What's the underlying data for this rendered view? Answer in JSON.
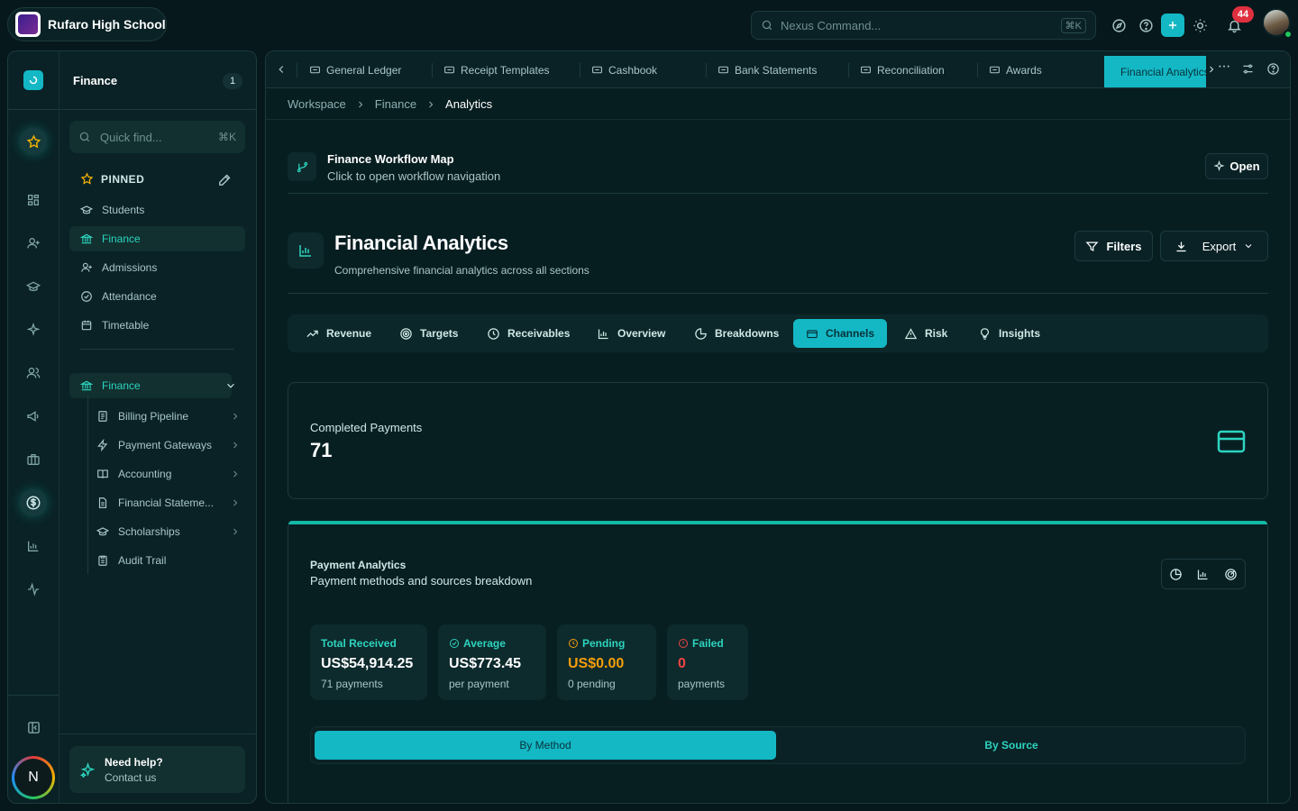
{
  "school": {
    "name": "Rufaro High School"
  },
  "header": {
    "command_placeholder": "Nexus Command...",
    "command_shortcut": "⌘K",
    "notification_count": "44",
    "avatar_initial": "N"
  },
  "sidebar": {
    "title": "Finance",
    "count": "1",
    "quick_find_placeholder": "Quick find...",
    "quick_find_shortcut": "⌘K",
    "pinned_label": "PINNED",
    "pinned": [
      {
        "label": "Students",
        "icon": "graduation-cap-icon"
      },
      {
        "label": "Finance",
        "icon": "bank-icon",
        "active": true
      },
      {
        "label": "Admissions",
        "icon": "user-plus-icon"
      },
      {
        "label": "Attendance",
        "icon": "check-circle-icon"
      },
      {
        "label": "Timetable",
        "icon": "calendar-icon"
      }
    ],
    "section": {
      "label": "Finance",
      "icon": "bank-icon"
    },
    "sub_items": [
      {
        "label": "Billing Pipeline",
        "icon": "receipt-icon"
      },
      {
        "label": "Payment Gateways",
        "icon": "bolt-icon"
      },
      {
        "label": "Accounting",
        "icon": "book-icon"
      },
      {
        "label": "Financial Stateme...",
        "icon": "document-icon"
      },
      {
        "label": "Scholarships",
        "icon": "graduation-cap-icon"
      },
      {
        "label": "Audit Trail",
        "icon": "clipboard-icon"
      }
    ],
    "help_title": "Need help?",
    "help_sub": "Contact us"
  },
  "tabs": [
    {
      "label": "General Ledger"
    },
    {
      "label": "Receipt Templates"
    },
    {
      "label": "Cashbook"
    },
    {
      "label": "Bank Statements"
    },
    {
      "label": "Reconciliation"
    },
    {
      "label": "Awards"
    },
    {
      "label": "Financial Analytics",
      "active": true
    }
  ],
  "breadcrumb": [
    "Workspace",
    "Finance",
    "Analytics"
  ],
  "workflow": {
    "title": "Finance Workflow Map",
    "subtitle": "Click to open workflow navigation",
    "open_label": "Open"
  },
  "page": {
    "title": "Financial Analytics",
    "subtitle": "Comprehensive financial analytics across all sections",
    "filters_label": "Filters",
    "export_label": "Export"
  },
  "segments": [
    {
      "label": "Revenue",
      "icon": "trend-up-icon"
    },
    {
      "label": "Targets",
      "icon": "target-icon"
    },
    {
      "label": "Receivables",
      "icon": "clock-icon"
    },
    {
      "label": "Overview",
      "icon": "bar-chart-icon"
    },
    {
      "label": "Breakdowns",
      "icon": "pie-chart-icon"
    },
    {
      "label": "Channels",
      "icon": "credit-card-icon",
      "active": true
    },
    {
      "label": "Risk",
      "icon": "warning-icon"
    },
    {
      "label": "Insights",
      "icon": "lightbulb-icon"
    }
  ],
  "completed": {
    "label": "Completed Payments",
    "value": "71"
  },
  "analytics": {
    "title": "Payment Analytics",
    "subtitle": "Payment methods and sources breakdown",
    "stats": [
      {
        "label": "Total Received",
        "value": "US$54,914.25",
        "sub": "71 payments",
        "color": "#ffffff"
      },
      {
        "label": "Average",
        "value": "US$773.45",
        "sub": "per payment",
        "color": "#ffffff"
      },
      {
        "label": "Pending",
        "value": "US$0.00",
        "sub": "0 pending",
        "color": "#f59e0b"
      },
      {
        "label": "Failed",
        "value": "0",
        "sub": "payments",
        "color": "#ef4444"
      }
    ],
    "toggle": [
      "By Method",
      "By Source"
    ]
  },
  "colors": {
    "accent": "#14b8c5",
    "success": "#14b8a6",
    "warning": "#f59e0b",
    "danger": "#ef4444"
  }
}
